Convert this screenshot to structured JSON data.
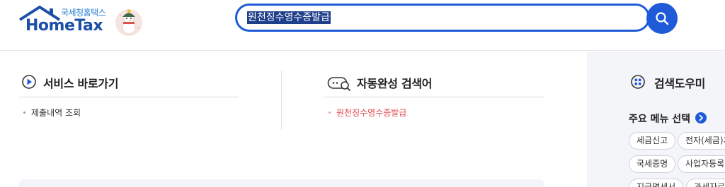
{
  "logo": {
    "sub": "국세청홈택스",
    "main": "HomeTax"
  },
  "search": {
    "value": "원천징수영수증발급"
  },
  "services": {
    "title": "서비스 바로가기",
    "items": [
      "제출내역 조회"
    ]
  },
  "autocomplete": {
    "title": "자동완성 검색어",
    "items": [
      "원천징수영수증발급"
    ]
  },
  "helper": {
    "title": "검색도우미",
    "sub_title": "주요 메뉴 선택",
    "chips": [
      "세금신고",
      "전자(세금)계",
      "국세증명",
      "사업자등록",
      "지급명세서",
      "과세자료"
    ]
  },
  "colors": {
    "accent": "#1f5bd8",
    "highlight": "#e0454d"
  }
}
